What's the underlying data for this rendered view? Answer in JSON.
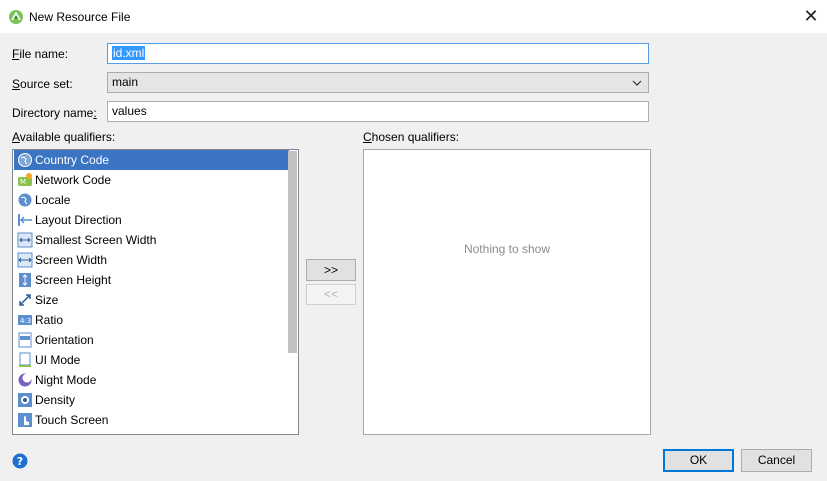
{
  "window": {
    "title": "New Resource File",
    "close_glyph": "✕"
  },
  "form": {
    "file_name": {
      "label_accel": "F",
      "label_rest": "ile name:",
      "value": "id.xml"
    },
    "source_set": {
      "label_accel": "S",
      "label_rest": "ource set:",
      "value": "main"
    },
    "directory_name": {
      "label_pre": "Directory name",
      "label_accel": ":",
      "label_rest": "",
      "value": "values"
    }
  },
  "available": {
    "label_accel": "A",
    "label_rest": "vailable qualifiers:",
    "items": [
      {
        "label": "Country Code",
        "icon": "globe-icon",
        "selected": true
      },
      {
        "label": "Network Code",
        "icon": "network-icon"
      },
      {
        "label": "Locale",
        "icon": "globe-icon"
      },
      {
        "label": "Layout Direction",
        "icon": "layout-direction-icon"
      },
      {
        "label": "Smallest Screen Width",
        "icon": "smallest-width-icon"
      },
      {
        "label": "Screen Width",
        "icon": "screen-width-icon"
      },
      {
        "label": "Screen Height",
        "icon": "screen-height-icon"
      },
      {
        "label": "Size",
        "icon": "size-icon"
      },
      {
        "label": "Ratio",
        "icon": "ratio-icon"
      },
      {
        "label": "Orientation",
        "icon": "orientation-icon"
      },
      {
        "label": "UI Mode",
        "icon": "ui-mode-icon"
      },
      {
        "label": "Night Mode",
        "icon": "night-mode-icon"
      },
      {
        "label": "Density",
        "icon": "density-icon"
      },
      {
        "label": "Touch Screen",
        "icon": "touch-screen-icon"
      }
    ]
  },
  "chosen": {
    "label_accel": "C",
    "label_rest": "hosen qualifiers:",
    "empty_text": "Nothing to show"
  },
  "buttons": {
    "add": ">>",
    "remove": "<<",
    "ok": "OK",
    "cancel": "Cancel"
  },
  "colors": {
    "accent": "#0078d7",
    "selection": "#3a74c2"
  }
}
